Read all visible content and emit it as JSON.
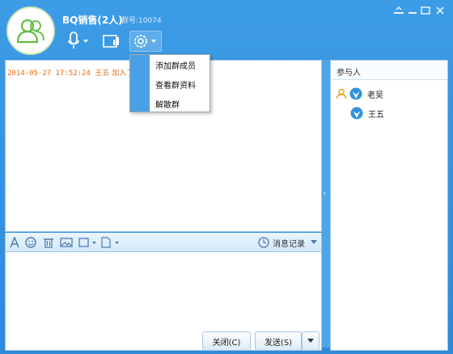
{
  "window": {
    "title": "BQ销售(2人)",
    "group_number": "群号:10074",
    "colors": {
      "titlebar": "#3396e1",
      "accent": "#4aa0e6"
    }
  },
  "titlebar_controls": [
    "menu-icon",
    "minimize-icon",
    "maximize-icon",
    "close-icon"
  ],
  "toolbar": {
    "icons": [
      "microphone-icon",
      "screen-share-icon",
      "gear-icon"
    ]
  },
  "chat": {
    "messages": [
      {
        "timestamp": "2014-05-27 17:52:24",
        "text": "王五 加入了群"
      }
    ]
  },
  "context_menu": {
    "items": [
      {
        "label": "添加群成员"
      },
      {
        "label": "查看群资料"
      },
      {
        "label": "解散群"
      }
    ]
  },
  "format_bar": {
    "icons": [
      "font-icon",
      "emoji-icon",
      "delete-icon",
      "image-icon",
      "screenshot-icon",
      "file-icon"
    ],
    "history_label": "消息记录"
  },
  "actions": {
    "close_label": "关闭(C)",
    "send_label": "发送(S)"
  },
  "participants": {
    "header": "参与人",
    "members": [
      {
        "name": "老吴",
        "role": "owner"
      },
      {
        "name": "王五",
        "role": "member"
      }
    ]
  }
}
